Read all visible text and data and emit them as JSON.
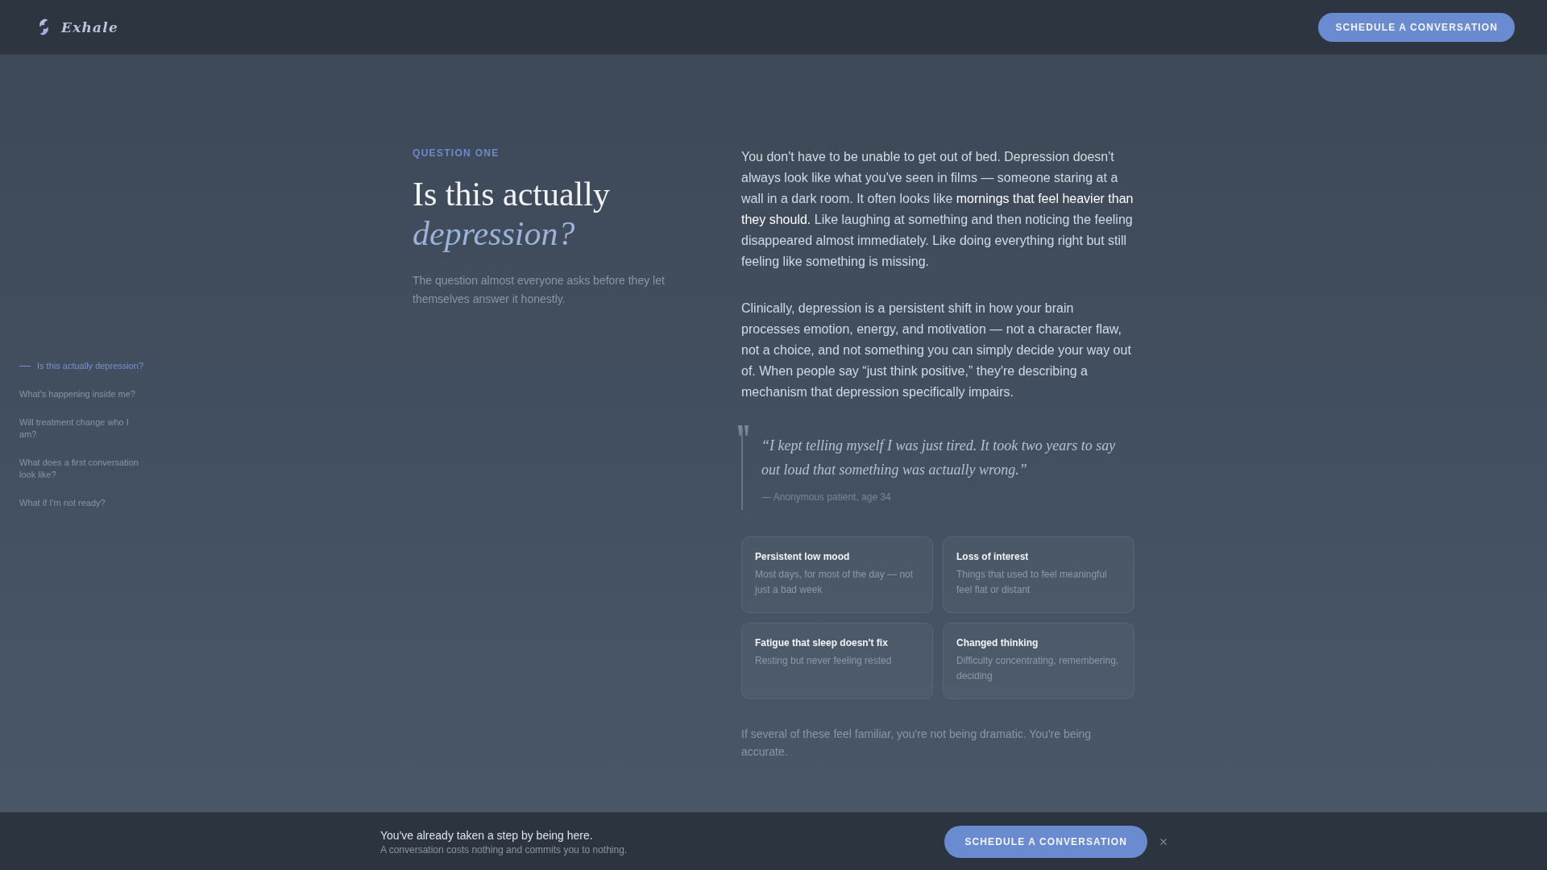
{
  "header": {
    "logo": "Exhale",
    "button": "SCHEDULE A CONVERSATION"
  },
  "nav": {
    "items": [
      {
        "label": "Is this actually depression?",
        "selected": true
      },
      {
        "label": "What's happening inside me?",
        "selected": false
      },
      {
        "label": "Will treatment change who I am?",
        "selected": false
      },
      {
        "label": "What does a first conversation look like?",
        "selected": false
      },
      {
        "label": "What if I'm not ready?",
        "selected": false
      }
    ]
  },
  "section": {
    "eyebrow": "QUESTION ONE",
    "title": "Is this actually *depression?*",
    "subtitle": "The question almost everyone asks before they let themselves answer it honestly.",
    "paragraphs": [
      "You don't have to be unable to get out of bed. Depression doesn't always look like what you've seen in films — someone staring at a wall in a dark room. It often looks like **mornings that feel heavier than they should.** Like laughing at something and then noticing the feeling disappeared almost immediately. Like doing everything right but still feeling like something is missing.",
      "Clinically, depression is a persistent shift in how your brain processes emotion, energy, and motivation — not a character flaw, not a choice, and not something you can simply decide your way out of. When people say “just think positive,” they're describing a mechanism that depression specifically impairs."
    ],
    "quote": {
      "text": "“I kept telling myself I was just tired. It took two years to say out loud that something was actually wrong.”",
      "attribution": "— Anonymous patient, age 34"
    },
    "cards": [
      {
        "title": "Persistent low mood",
        "text": "Most days, for most of the day — not just a bad week"
      },
      {
        "title": "Loss of interest",
        "text": "Things that used to feel meaningful feel flat or distant"
      },
      {
        "title": "Fatigue that sleep doesn't fix",
        "text": "Resting but never feeling rested"
      },
      {
        "title": "Changed thinking",
        "text": "Difficulty concentrating, remembering, deciding"
      }
    ],
    "closing": "If several of these feel familiar, you're not being dramatic. You're being accurate."
  },
  "cta_bar": {
    "title": "You've already taken a step by being here.",
    "subtitle": "A conversation costs nothing and commits you to nothing.",
    "button": "SCHEDULE A CONVERSATION"
  }
}
